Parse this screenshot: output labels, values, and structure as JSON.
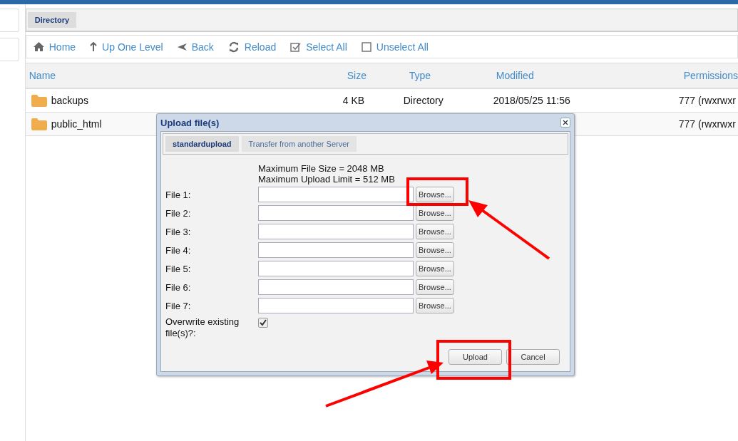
{
  "breadcrumb": {
    "label": "Directory"
  },
  "toolbar": [
    {
      "label": "Home",
      "kind": "home"
    },
    {
      "label": "Up One Level",
      "kind": "up"
    },
    {
      "label": "Back",
      "kind": "back"
    },
    {
      "label": "Reload",
      "kind": "reload"
    },
    {
      "label": "Select All",
      "kind": "select"
    },
    {
      "label": "Unselect All",
      "kind": "unselect"
    }
  ],
  "table": {
    "columns": [
      "Name",
      "Size",
      "Type",
      "Modified",
      "Permissions"
    ],
    "rows": [
      {
        "name": "backups",
        "size": "4 KB",
        "type": "Directory",
        "modified": "2018/05/25 11:56",
        "permissions": "777 (rwxrwxr"
      },
      {
        "name": "public_html",
        "permissions": "777 (rwxrwxr"
      }
    ]
  },
  "dialog": {
    "title": "Upload file(s)",
    "tabs": [
      {
        "label": "standardupload",
        "selected": true
      },
      {
        "label": "Transfer from another Server",
        "selected": false
      }
    ],
    "limits": [
      "Maximum File Size = 2048 MB",
      "Maximum Upload Limit = 512 MB"
    ],
    "files": [
      {
        "label": "File 1:",
        "button": "Browse..."
      },
      {
        "label": "File 2:",
        "button": "Browse..."
      },
      {
        "label": "File 3:",
        "button": "Browse..."
      },
      {
        "label": "File 4:",
        "button": "Browse..."
      },
      {
        "label": "File 5:",
        "button": "Browse..."
      },
      {
        "label": "File 6:",
        "button": "Browse..."
      },
      {
        "label": "File 7:",
        "button": "Browse..."
      }
    ],
    "overwrite": {
      "label": "Overwrite existing file(s)?:",
      "checked": true
    },
    "buttons": [
      "Upload",
      "Cancel"
    ]
  }
}
